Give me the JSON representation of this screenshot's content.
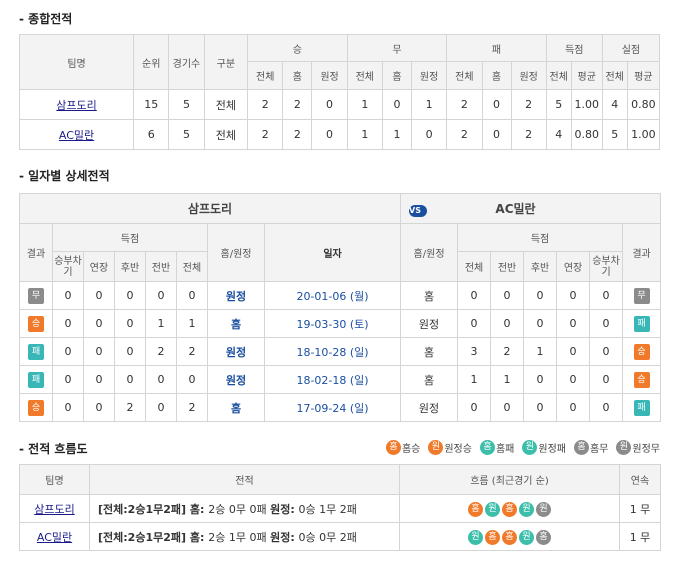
{
  "sections": {
    "summary_title": "- 종합전적",
    "daily_title": "- 일자별 상세전적",
    "flow_title": "- 전적 흐름도"
  },
  "summary": {
    "headers": {
      "team": "팀명",
      "rank": "순위",
      "games": "경기수",
      "type": "구분",
      "win": "승",
      "draw": "무",
      "loss": "패",
      "scored": "득점",
      "conceded": "실점",
      "total": "전체",
      "home": "홈",
      "away": "원정",
      "avg": "평균"
    },
    "rows": [
      {
        "team": "삼프도리",
        "rank": "15",
        "games": "5",
        "type": "전체",
        "w": [
          "2",
          "2",
          "0"
        ],
        "d": [
          "1",
          "0",
          "1"
        ],
        "l": [
          "2",
          "0",
          "2"
        ],
        "gf": [
          "5",
          "1.00"
        ],
        "ga": [
          "4",
          "0.80"
        ]
      },
      {
        "team": "AC밀란",
        "rank": "6",
        "games": "5",
        "type": "전체",
        "w": [
          "2",
          "2",
          "0"
        ],
        "d": [
          "1",
          "1",
          "0"
        ],
        "l": [
          "2",
          "0",
          "2"
        ],
        "gf": [
          "4",
          "0.80"
        ],
        "ga": [
          "5",
          "1.00"
        ]
      }
    ]
  },
  "daily": {
    "team_left": "삼프도리",
    "team_right": "AC밀란",
    "vs_label": "VS",
    "headers": {
      "result": "결과",
      "score": "득점",
      "shootout": "승부차기",
      "extra": "연장",
      "second": "후반",
      "first": "전반",
      "total": "전체",
      "venue": "홈/원정",
      "date": "일자"
    },
    "rows": [
      {
        "lres": "무",
        "lcls": "b-draw",
        "l": [
          "0",
          "0",
          "0",
          "0",
          "0"
        ],
        "lvenue": "원정",
        "date": "20-01-06 (월)",
        "rvenue": "홈",
        "r": [
          "0",
          "0",
          "0",
          "0",
          "0"
        ],
        "rres": "무",
        "rcls": "b-draw"
      },
      {
        "lres": "승",
        "lcls": "b-win",
        "l": [
          "0",
          "0",
          "0",
          "1",
          "1"
        ],
        "lvenue": "홈",
        "date": "19-03-30 (토)",
        "rvenue": "원정",
        "r": [
          "0",
          "0",
          "0",
          "0",
          "0"
        ],
        "rres": "패",
        "rcls": "b-loss"
      },
      {
        "lres": "패",
        "lcls": "b-loss",
        "l": [
          "0",
          "0",
          "0",
          "2",
          "2"
        ],
        "lvenue": "원정",
        "date": "18-10-28 (일)",
        "rvenue": "홈",
        "r": [
          "3",
          "2",
          "1",
          "0",
          "0"
        ],
        "rres": "승",
        "rcls": "b-win"
      },
      {
        "lres": "패",
        "lcls": "b-loss",
        "l": [
          "0",
          "0",
          "0",
          "0",
          "0"
        ],
        "lvenue": "원정",
        "date": "18-02-18 (일)",
        "rvenue": "홈",
        "r": [
          "1",
          "1",
          "0",
          "0",
          "0"
        ],
        "rres": "승",
        "rcls": "b-win"
      },
      {
        "lres": "승",
        "lcls": "b-win",
        "l": [
          "0",
          "0",
          "2",
          "0",
          "2"
        ],
        "lvenue": "홈",
        "date": "17-09-24 (일)",
        "rvenue": "원정",
        "r": [
          "0",
          "0",
          "0",
          "0",
          "0"
        ],
        "rres": "패",
        "rcls": "b-loss"
      }
    ]
  },
  "legend": [
    {
      "glyph": "홈",
      "cls": "c-hw",
      "label": "홈승"
    },
    {
      "glyph": "원",
      "cls": "c-aw",
      "label": "원정승"
    },
    {
      "glyph": "홈",
      "cls": "c-hl",
      "label": "홈패"
    },
    {
      "glyph": "원",
      "cls": "c-al",
      "label": "원정패"
    },
    {
      "glyph": "홈",
      "cls": "c-hd",
      "label": "홈무"
    },
    {
      "glyph": "원",
      "cls": "c-ad",
      "label": "원정무"
    }
  ],
  "flow": {
    "headers": {
      "team": "팀명",
      "record": "전적",
      "flow": "흐름 (최근경기 순)",
      "streak": "연속"
    },
    "rows": [
      {
        "team": "삼프도리",
        "rec_bold": "[전체:2승1무2패]",
        "rec_home_label": "홈:",
        "rec_home": "2승 0무 0패",
        "rec_away_label": "원정:",
        "rec_away": "0승 1무 2패",
        "flow": [
          {
            "g": "홈",
            "c": "c-hw"
          },
          {
            "g": "원",
            "c": "c-al"
          },
          {
            "g": "홈",
            "c": "c-hw"
          },
          {
            "g": "원",
            "c": "c-al"
          },
          {
            "g": "원",
            "c": "c-ad"
          }
        ],
        "streak": "1 무"
      },
      {
        "team": "AC밀란",
        "rec_bold": "[전체:2승1무2패]",
        "rec_home_label": "홈:",
        "rec_home": "2승 1무 0패",
        "rec_away_label": "원정:",
        "rec_away": "0승 0무 2패",
        "flow": [
          {
            "g": "원",
            "c": "c-al"
          },
          {
            "g": "홈",
            "c": "c-hw"
          },
          {
            "g": "홈",
            "c": "c-hw"
          },
          {
            "g": "원",
            "c": "c-al"
          },
          {
            "g": "홈",
            "c": "c-hd"
          }
        ],
        "streak": "1 무"
      }
    ]
  }
}
